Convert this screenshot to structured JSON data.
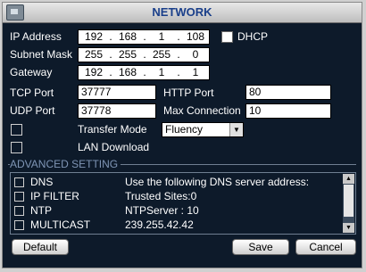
{
  "window": {
    "title": "NETWORK"
  },
  "fields": {
    "ip_address": {
      "label": "IP Address",
      "octets": [
        "192",
        "168",
        "1",
        "108"
      ]
    },
    "subnet_mask": {
      "label": "Subnet Mask",
      "octets": [
        "255",
        "255",
        "255",
        "0"
      ]
    },
    "gateway": {
      "label": "Gateway",
      "octets": [
        "192",
        "168",
        "1",
        "1"
      ]
    },
    "dhcp": {
      "label": "DHCP",
      "checked": false
    },
    "tcp_port": {
      "label": "TCP Port",
      "value": "37777"
    },
    "udp_port": {
      "label": "UDP Port",
      "value": "37778"
    },
    "http_port": {
      "label": "HTTP Port",
      "value": "80"
    },
    "max_connection": {
      "label": "Max Connection",
      "value": "10"
    },
    "transfer_mode": {
      "label": "Transfer Mode",
      "value": "Fluency"
    },
    "lan_download": {
      "label": "LAN Download"
    }
  },
  "advanced": {
    "title": "ADVANCED SETTING",
    "rows": [
      {
        "name": "DNS",
        "value": "Use the following DNS server address:"
      },
      {
        "name": "IP FILTER",
        "value": "Trusted Sites:0"
      },
      {
        "name": "NTP",
        "value": "NTPServer : 10"
      },
      {
        "name": "MULTICAST",
        "value": "239.255.42.42"
      }
    ]
  },
  "buttons": {
    "default": "Default",
    "save": "Save",
    "cancel": "Cancel"
  }
}
